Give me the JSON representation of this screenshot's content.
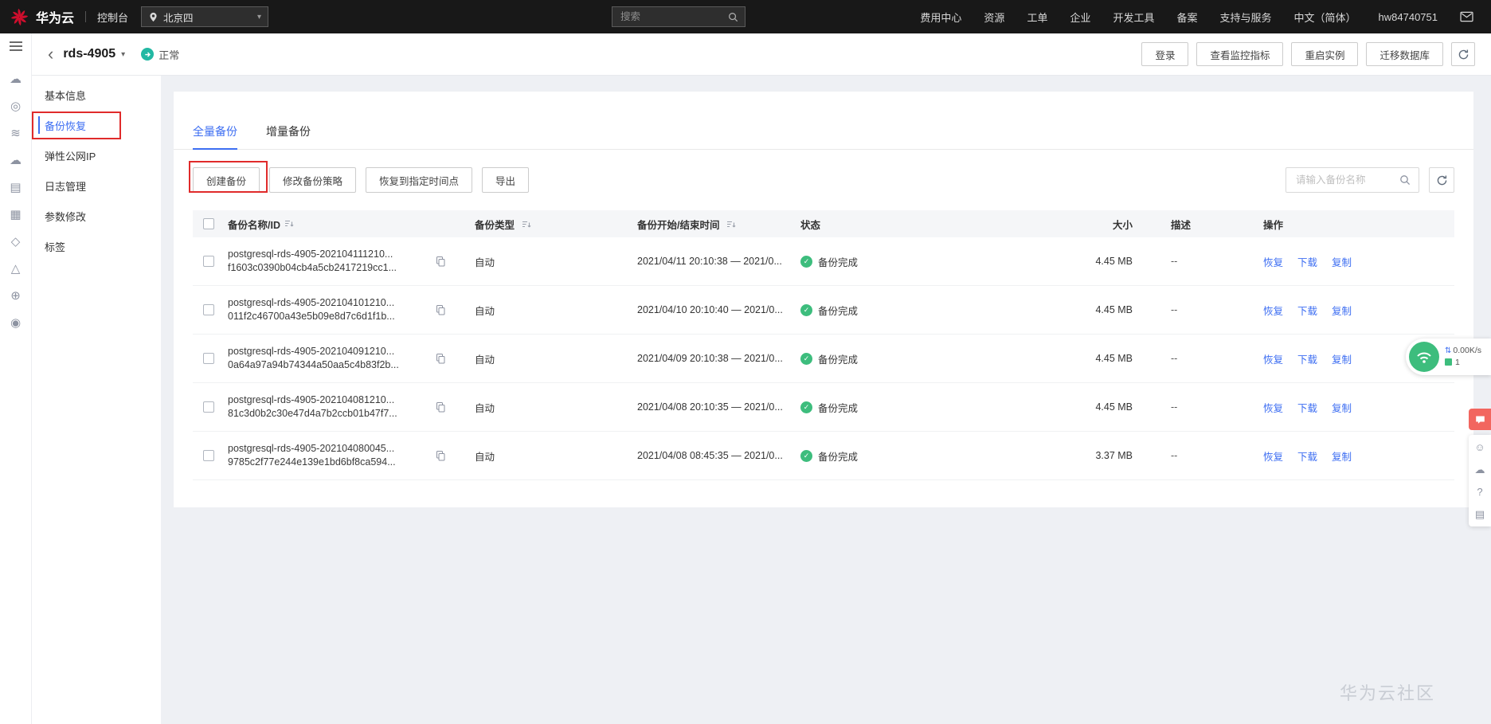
{
  "topbar": {
    "brand": "华为云",
    "console_label": "控制台",
    "region": "北京四",
    "search_placeholder": "搜索",
    "menu_items": [
      "费用中心",
      "资源",
      "工单",
      "企业",
      "开发工具",
      "备案",
      "支持与服务",
      "中文（简体）",
      "hw84740751"
    ]
  },
  "header": {
    "title": "rds-4905",
    "status": "正常",
    "buttons": {
      "login": "登录",
      "monitor": "查看监控指标",
      "restart": "重启实例",
      "migrate": "迁移数据库"
    }
  },
  "sidebar": {
    "items": [
      "基本信息",
      "备份恢复",
      "弹性公网IP",
      "日志管理",
      "参数修改",
      "标签"
    ],
    "active_item": "备份恢复"
  },
  "rail": {
    "icons": [
      {
        "name": "console-icon",
        "glyph": "☁"
      },
      {
        "name": "user-group-icon",
        "glyph": "◎"
      },
      {
        "name": "auto-scaling-icon",
        "glyph": "≋"
      },
      {
        "name": "cloud-service-icon",
        "glyph": "☁"
      },
      {
        "name": "document-icon",
        "glyph": "▤"
      },
      {
        "name": "log-icon",
        "glyph": "▦"
      },
      {
        "name": "cloud-backup-icon",
        "glyph": "◇"
      },
      {
        "name": "experiment-icon",
        "glyph": "△"
      },
      {
        "name": "globe-icon",
        "glyph": "⊕"
      },
      {
        "name": "support-icon",
        "glyph": "◉"
      }
    ]
  },
  "tabs": {
    "full_backup": "全量备份",
    "incremental_backup": "增量备份"
  },
  "toolbar": {
    "create": "创建备份",
    "modify_policy": "修改备份策略",
    "restore_point": "恢复到指定时间点",
    "export": "导出",
    "search_placeholder": "请输入备份名称"
  },
  "table": {
    "headers": {
      "name": "备份名称/ID",
      "type": "备份类型",
      "time": "备份开始/结束时间",
      "status": "状态",
      "size": "大小",
      "desc": "描述",
      "actions": "操作"
    },
    "row_actions": {
      "restore": "恢复",
      "download": "下载",
      "copy": "复制"
    },
    "rows": [
      {
        "name": "postgresql-rds-4905-202104111210...",
        "id": "f1603c0390b04cb4a5cb2417219cc1...",
        "type": "自动",
        "time": "2021/04/11 20:10:38 — 2021/0...",
        "status": "备份完成",
        "size": "4.45 MB",
        "desc": "--"
      },
      {
        "name": "postgresql-rds-4905-202104101210...",
        "id": "011f2c46700a43e5b09e8d7c6d1f1b...",
        "type": "自动",
        "time": "2021/04/10 20:10:40 — 2021/0...",
        "status": "备份完成",
        "size": "4.45 MB",
        "desc": "--"
      },
      {
        "name": "postgresql-rds-4905-202104091210...",
        "id": "0a64a97a94b74344a50aa5c4b83f2b...",
        "type": "自动",
        "time": "2021/04/09 20:10:38 — 2021/0...",
        "status": "备份完成",
        "size": "4.45 MB",
        "desc": "--"
      },
      {
        "name": "postgresql-rds-4905-202104081210...",
        "id": "81c3d0b2c30e47d4a7b2ccb01b47f7...",
        "type": "自动",
        "time": "2021/04/08 20:10:35 — 2021/0...",
        "status": "备份完成",
        "size": "4.45 MB",
        "desc": "--"
      },
      {
        "name": "postgresql-rds-4905-202104080045...",
        "id": "9785c2f77e244e139e1bd6bf8ca594...",
        "type": "自动",
        "time": "2021/04/08 08:45:35 — 2021/0...",
        "status": "备份完成",
        "size": "3.37 MB",
        "desc": "--"
      }
    ]
  },
  "net_widget": {
    "speed": "0.00K/s",
    "count": "1"
  },
  "side_tools": {
    "icons": [
      {
        "name": "emoji-icon",
        "glyph": "☺"
      },
      {
        "name": "cloud-download-icon",
        "glyph": "☁"
      },
      {
        "name": "help-icon",
        "glyph": "?"
      },
      {
        "name": "survey-icon",
        "glyph": "▤"
      }
    ]
  },
  "watermark": "华为云社区",
  "colors": {
    "topbar_bg": "#181818",
    "brand_red": "#ce0e2d",
    "link_blue": "#3d6ef2",
    "success_green": "#3dbd7d",
    "running_teal": "#22b8a3",
    "annotation_red": "#e02b2b"
  }
}
